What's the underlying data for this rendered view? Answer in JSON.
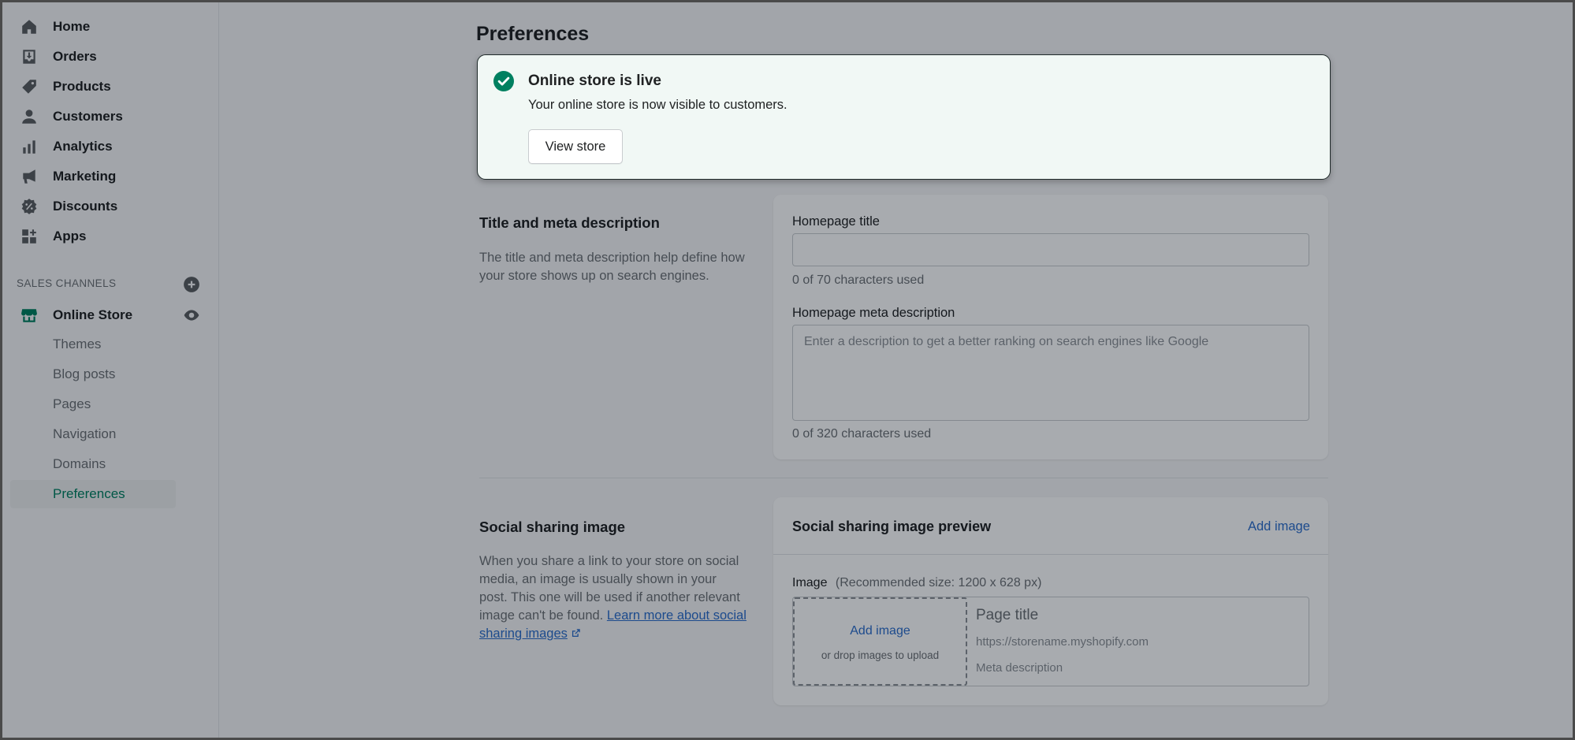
{
  "sidebar": {
    "nav": [
      {
        "label": "Home",
        "icon": "home-icon"
      },
      {
        "label": "Orders",
        "icon": "orders-icon"
      },
      {
        "label": "Products",
        "icon": "tag-icon"
      },
      {
        "label": "Customers",
        "icon": "person-icon"
      },
      {
        "label": "Analytics",
        "icon": "bar-chart-icon"
      },
      {
        "label": "Marketing",
        "icon": "megaphone-icon"
      },
      {
        "label": "Discounts",
        "icon": "discount-icon"
      },
      {
        "label": "Apps",
        "icon": "apps-icon"
      }
    ],
    "sales_channels_label": "SALES CHANNELS",
    "online_store_label": "Online Store",
    "sub_items": [
      "Themes",
      "Blog posts",
      "Pages",
      "Navigation",
      "Domains",
      "Preferences"
    ],
    "active_sub_item": "Preferences"
  },
  "page": {
    "title": "Preferences"
  },
  "banner": {
    "title": "Online store is live",
    "text": "Your online store is now visible to customers.",
    "button_label": "View store"
  },
  "title_meta": {
    "heading": "Title and meta description",
    "description": "The title and meta description help define how your store shows up on search engines.",
    "homepage_title_label": "Homepage title",
    "homepage_title_value": "",
    "homepage_title_count": "0 of 70 characters used",
    "meta_description_label": "Homepage meta description",
    "meta_description_placeholder": "Enter a description to get a better ranking on search engines like Google",
    "meta_description_count": "0 of 320 characters used"
  },
  "social": {
    "heading": "Social sharing image",
    "description": "When you share a link to your store on social media, an image is usually shown in your post. This one will be used if another relevant image can't be found.",
    "learn_more_link": "Learn more about social sharing images",
    "preview_heading": "Social sharing image preview",
    "add_image_link": "Add image",
    "image_label": "Image",
    "image_hint": "(Recommended size: 1200 x 628 px)",
    "drop_add_image": "Add image",
    "drop_hint": "or drop images to upload",
    "preview_page_title": "Page title",
    "preview_url": "https://storename.myshopify.com",
    "preview_meta": "Meta description"
  },
  "colors": {
    "accent": "#008060",
    "link": "#2c6ecb",
    "banner_bg": "#f1f8f5"
  }
}
